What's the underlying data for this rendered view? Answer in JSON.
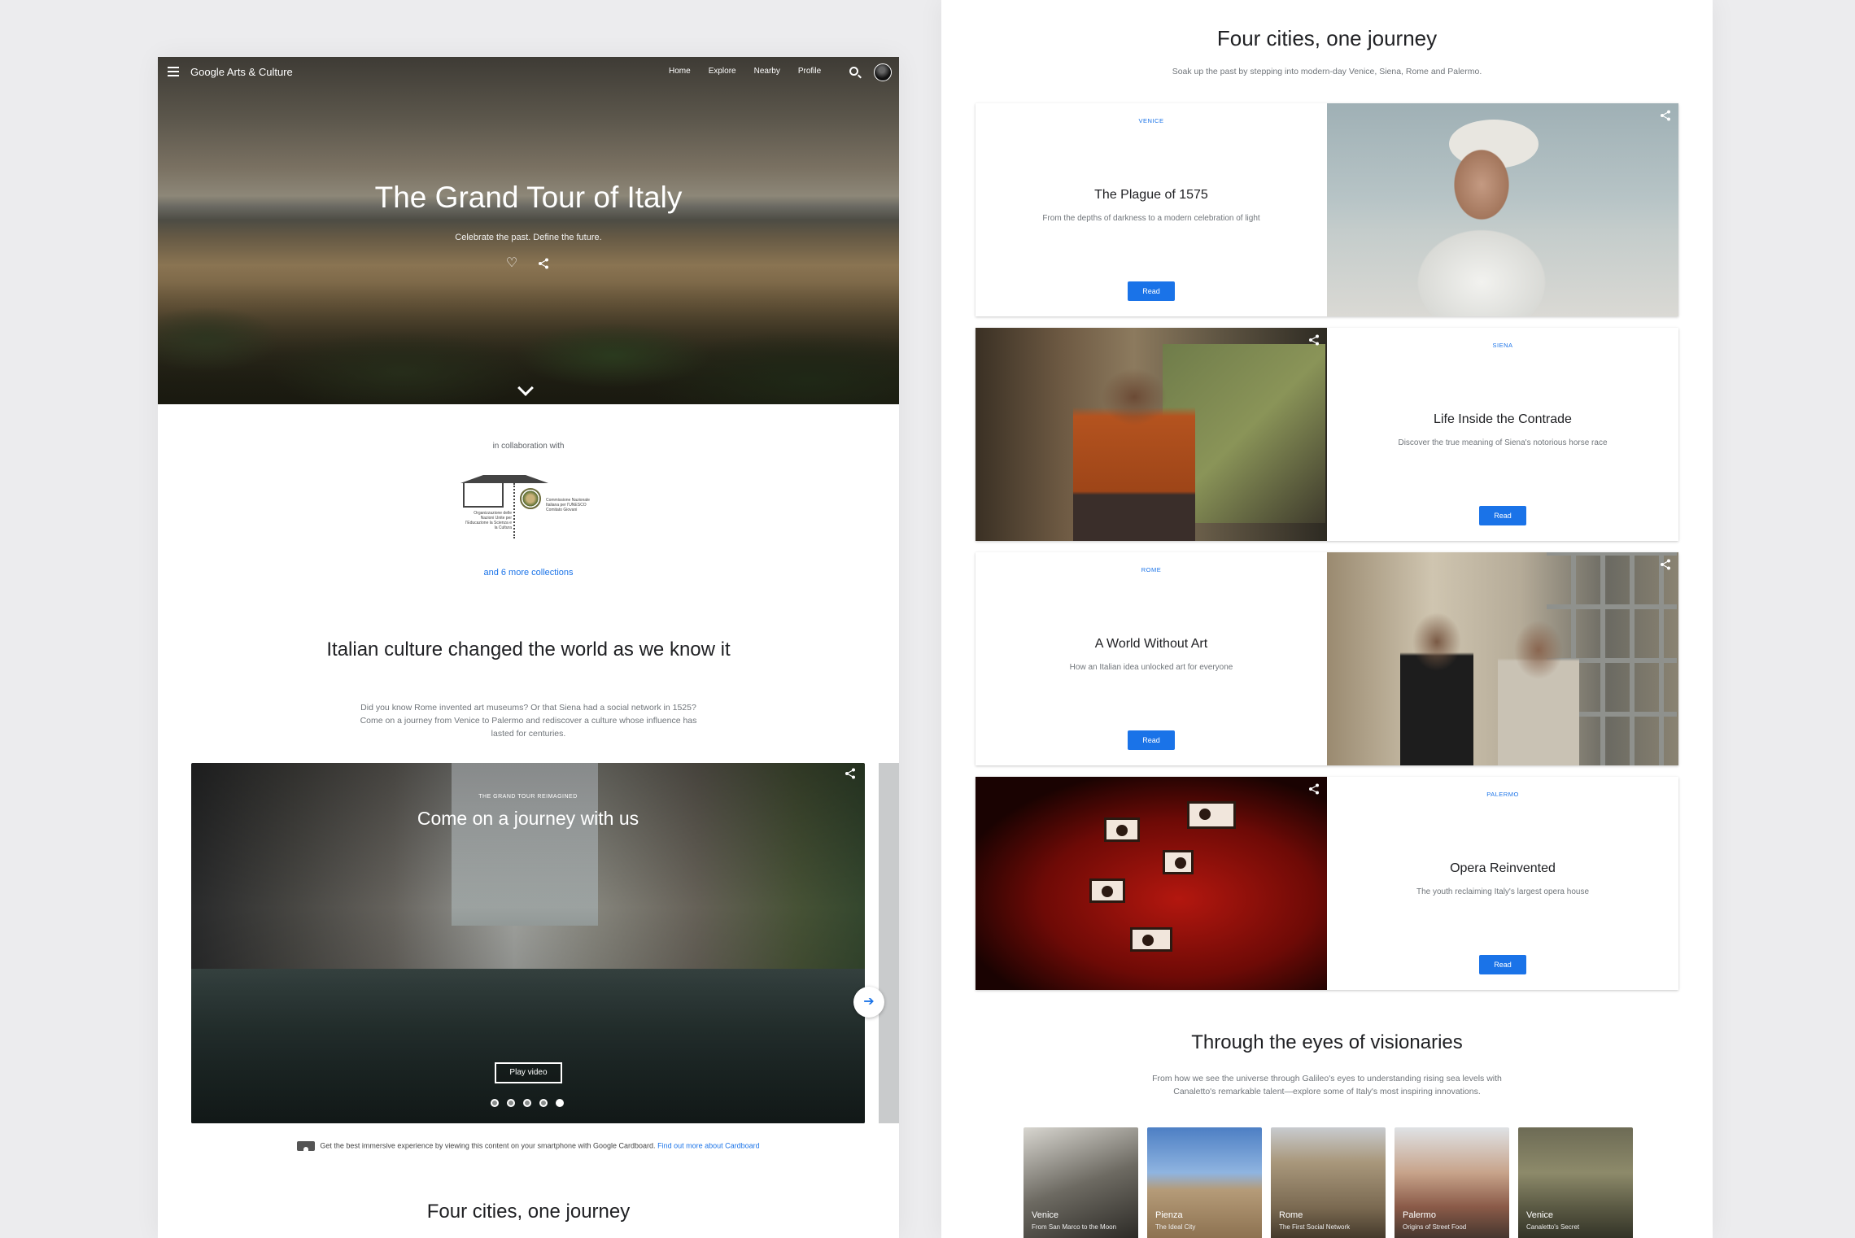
{
  "left": {
    "brand": "Google Arts & Culture",
    "nav": [
      "Home",
      "Explore",
      "Nearby",
      "Profile"
    ],
    "hero": {
      "title": "The Grand Tour of Italy",
      "subtitle": "Celebrate the past. Define the future."
    },
    "collab_label": "in collaboration with",
    "logos": {
      "unesco_text": "Organizzazione delle Nazioni Unite per l'Educazione la Scienza e la Cultura",
      "commission_text": "Commissione Nazionale Italiana per l'UNESCO Comitato Giovani"
    },
    "more_collections": "and 6 more collections",
    "section": {
      "title": "Italian culture changed the world as we know it",
      "body_line1": "Did you know Rome invented art museums? Or that Siena had a social network in 1525?",
      "body_line2": "Come on a journey from Venice to Palermo and rediscover a culture whose influence has",
      "body_line3": "lasted for centuries."
    },
    "video": {
      "kicker": "THE GRAND TOUR REIMAGINED",
      "title": "Come on a journey with us",
      "play_label": "Play video",
      "slides": 5,
      "active_slide": 5
    },
    "cardboard": {
      "text": "Get the best immersive experience by viewing this content on your smartphone with Google Cardboard.",
      "link": "Find out more about Cardboard"
    },
    "bottom_title": "Four cities, one journey"
  },
  "right": {
    "title": "Four cities, one journey",
    "subtitle": "Soak up the past by stepping into modern-day Venice, Siena, Rome and Palermo.",
    "cities": [
      {
        "kicker": "VENICE",
        "title": "The Plague of 1575",
        "desc": "From the depths of darkness to a modern celebration of light",
        "button": "Read"
      },
      {
        "kicker": "SIENA",
        "title": "Life Inside the Contrade",
        "desc": "Discover the true meaning of Siena's notorious horse race",
        "button": "Read"
      },
      {
        "kicker": "ROME",
        "title": "A World Without Art",
        "desc": "How an Italian idea unlocked art for everyone",
        "button": "Read"
      },
      {
        "kicker": "PALERMO",
        "title": "Opera Reinvented",
        "desc": "The youth reclaiming Italy's largest opera house",
        "button": "Read"
      }
    ],
    "visionaries": {
      "title": "Through the eyes of visionaries",
      "body_line1": "From how we see the universe through Galileo's eyes to understanding rising sea levels with",
      "body_line2": "Canaletto's remarkable talent—explore some of Italy's most inspiring innovations.",
      "cards": [
        {
          "city": "Venice",
          "sub": "From San Marco to the Moon"
        },
        {
          "city": "Pienza",
          "sub": "The Ideal City"
        },
        {
          "city": "Rome",
          "sub": "The First Social Network"
        },
        {
          "city": "Palermo",
          "sub": "Origins of Street Food"
        },
        {
          "city": "Venice",
          "sub": "Canaletto's Secret"
        }
      ]
    }
  }
}
